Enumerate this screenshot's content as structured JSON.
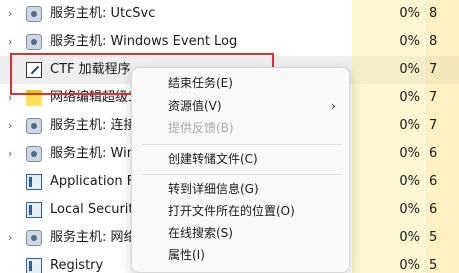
{
  "processes": [
    {
      "expander": "›",
      "icon": "gear-icon",
      "name": "服务主机: UtcSvc",
      "cpu": "0%",
      "mem": "8"
    },
    {
      "expander": "›",
      "icon": "gear-icon",
      "name": "服务主机: Windows Event Log",
      "cpu": "0%",
      "mem": "8"
    },
    {
      "expander": "",
      "icon": "edit-icon",
      "name": "CTF 加载程序",
      "cpu": "0%",
      "mem": "7",
      "selected": true
    },
    {
      "expander": "›",
      "icon": "folder-icon",
      "name": "网络编辑超级工",
      "cpu": "0%",
      "mem": "7"
    },
    {
      "expander": "›",
      "icon": "gear-icon",
      "name": "服务主机: 连接",
      "cpu": "0%",
      "mem": "7"
    },
    {
      "expander": "›",
      "icon": "gear-icon",
      "name": "服务主机: Wind",
      "cpu": "0%",
      "mem": "6"
    },
    {
      "expander": "",
      "icon": "window-icon",
      "name": "Application Fr",
      "cpu": "0%",
      "mem": "6"
    },
    {
      "expander": "",
      "icon": "window-icon",
      "name": "Local Security",
      "cpu": "0%",
      "mem": "6"
    },
    {
      "expander": "›",
      "icon": "gear-icon",
      "name": "服务主机: 网络",
      "cpu": "0%",
      "mem": "5"
    },
    {
      "expander": "",
      "icon": "window-icon",
      "name": "Registry",
      "cpu": "0%",
      "mem": "5"
    }
  ],
  "context_menu": {
    "end_task": "结束任务(E)",
    "resource_values": "资源值(V)",
    "submenu_arrow": "›",
    "feedback": "提供反馈(B)",
    "create_dump": "创建转储文件(C)",
    "go_to_details": "转到详细信息(G)",
    "open_file_location": "打开文件所在的位置(O)",
    "search_online": "在线搜索(S)",
    "properties": "属性(I)"
  },
  "colors": {
    "highlight_border": "#e0322d",
    "cpu_column_bg": "#fdf4d2",
    "mem_column_bg": "#fdf0c2"
  }
}
